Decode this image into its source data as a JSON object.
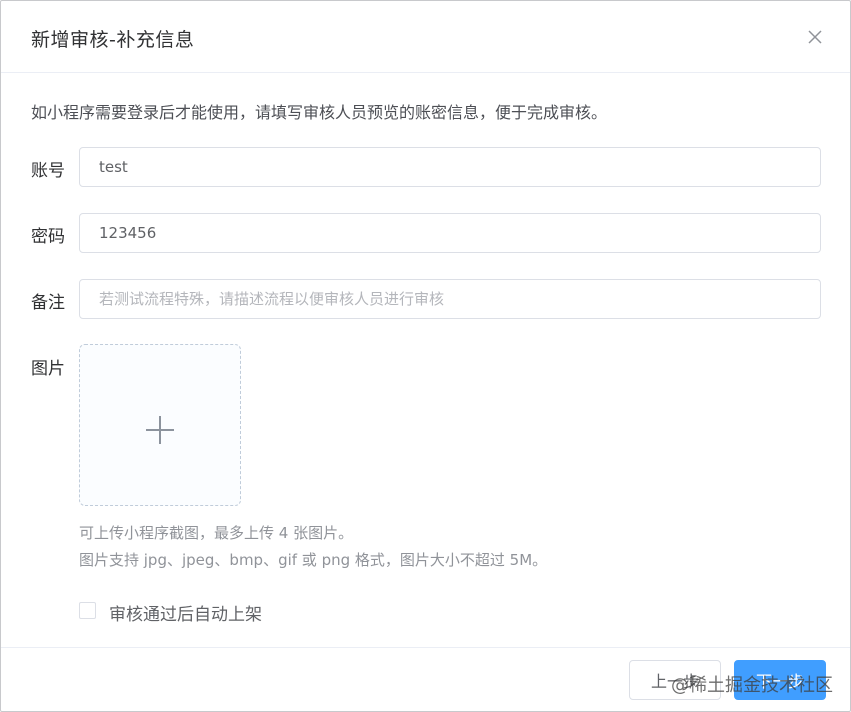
{
  "dialog": {
    "title": "新增审核-补充信息",
    "intro": "如小程序需要登录后才能使用，请填写审核人员预览的账密信息，便于完成审核。"
  },
  "form": {
    "account": {
      "label": "账号",
      "value": "test"
    },
    "password": {
      "label": "密码",
      "value": "123456"
    },
    "note": {
      "label": "备注",
      "value": "",
      "placeholder": "若测试流程特殊，请描述流程以便审核人员进行审核"
    },
    "image": {
      "label": "图片",
      "tip_line1": "可上传小程序截图，最多上传 4 张图片。",
      "tip_line2": "图片支持 jpg、jpeg、bmp、gif 或 png 格式，图片大小不超过 5M。"
    },
    "auto_publish": {
      "label": "审核通过后自动上架",
      "checked": false
    }
  },
  "footer": {
    "prev_label": "上一步",
    "next_label": "下一步"
  },
  "watermark": "@稀土掘金技术社区",
  "icons": {
    "close": "close-icon",
    "upload": "plus-icon"
  },
  "colors": {
    "primary": "#409eff",
    "border": "#dcdfe6"
  }
}
